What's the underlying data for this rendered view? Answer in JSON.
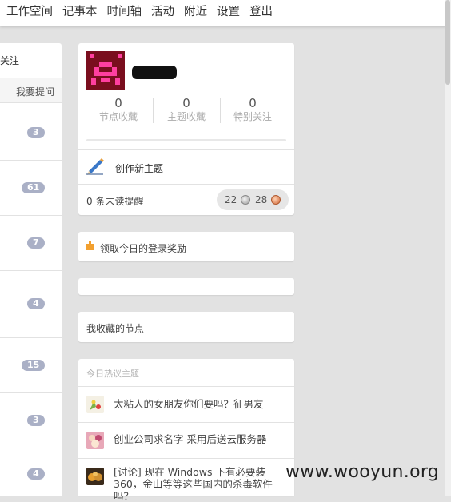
{
  "nav": {
    "items": [
      "工作空间",
      "记事本",
      "时间轴",
      "活动",
      "附近",
      "设置",
      "登出"
    ]
  },
  "left": {
    "follow_label": "关注",
    "ask_label": "我要提问",
    "counts": [
      "3",
      "61",
      "7",
      "4",
      "15",
      "3",
      "4"
    ]
  },
  "profile": {
    "stats": [
      {
        "value": "0",
        "label": "节点收藏"
      },
      {
        "value": "0",
        "label": "主题收藏"
      },
      {
        "value": "0",
        "label": "特别关注"
      }
    ],
    "progress": 0,
    "create_topic": "创作新主题",
    "unread": "0 条未读提醒",
    "silver_count": "22",
    "bronze_count": "28"
  },
  "reward": {
    "label": "领取今日的登录奖励"
  },
  "favorites": {
    "label": "我收藏的节点"
  },
  "hot": {
    "title": "今日热议主题",
    "topics": [
      "太粘人的女朋友你们要吗？征男友",
      "创业公司求名字 采用后送云服务器",
      "[讨论] 现在 Windows 下有必要装 360，金山等等这些国内的杀毒软件吗？"
    ]
  },
  "watermark": "www.wooyun.org"
}
